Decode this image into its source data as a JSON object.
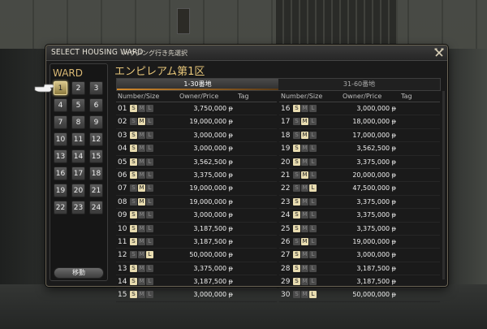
{
  "window": {
    "title": "SELECT HOUSING WARD",
    "subtitle": "ハウジング行き先選択",
    "close_icon": "crossed-hammers-icon"
  },
  "ward": {
    "label": "WARD",
    "selected": 1,
    "buttons": [
      "1",
      "2",
      "3",
      "4",
      "5",
      "6",
      "7",
      "8",
      "9",
      "10",
      "11",
      "12",
      "13",
      "14",
      "15",
      "16",
      "17",
      "18",
      "19",
      "20",
      "21",
      "22",
      "23",
      "24"
    ],
    "move_label": "移動"
  },
  "area_title": "エンピレアム第1区",
  "tabs": [
    {
      "label": "1-30番地",
      "active": true
    },
    {
      "label": "31-60番地",
      "active": false
    }
  ],
  "columns": {
    "number_size": "Number/Size",
    "owner_price": "Owner/Price",
    "tag": "Tag"
  },
  "size_letters": [
    "S",
    "M",
    "L"
  ],
  "plots": [
    {
      "num": "01",
      "size": "S",
      "price": "3,750,000 ᵽ"
    },
    {
      "num": "02",
      "size": "M",
      "price": "19,000,000 ᵽ"
    },
    {
      "num": "03",
      "size": "S",
      "price": "3,000,000 ᵽ"
    },
    {
      "num": "04",
      "size": "S",
      "price": "3,000,000 ᵽ"
    },
    {
      "num": "05",
      "size": "S",
      "price": "3,562,500 ᵽ"
    },
    {
      "num": "06",
      "size": "S",
      "price": "3,375,000 ᵽ"
    },
    {
      "num": "07",
      "size": "M",
      "price": "19,000,000 ᵽ"
    },
    {
      "num": "08",
      "size": "M",
      "price": "19,000,000 ᵽ"
    },
    {
      "num": "09",
      "size": "S",
      "price": "3,000,000 ᵽ"
    },
    {
      "num": "10",
      "size": "S",
      "price": "3,187,500 ᵽ"
    },
    {
      "num": "11",
      "size": "S",
      "price": "3,187,500 ᵽ"
    },
    {
      "num": "12",
      "size": "L",
      "price": "50,000,000 ᵽ"
    },
    {
      "num": "13",
      "size": "S",
      "price": "3,375,000 ᵽ"
    },
    {
      "num": "14",
      "size": "S",
      "price": "3,187,500 ᵽ"
    },
    {
      "num": "15",
      "size": "S",
      "price": "3,000,000 ᵽ"
    },
    {
      "num": "16",
      "size": "S",
      "price": "3,000,000 ᵽ"
    },
    {
      "num": "17",
      "size": "M",
      "price": "18,000,000 ᵽ"
    },
    {
      "num": "18",
      "size": "M",
      "price": "17,000,000 ᵽ"
    },
    {
      "num": "19",
      "size": "S",
      "price": "3,562,500 ᵽ"
    },
    {
      "num": "20",
      "size": "S",
      "price": "3,375,000 ᵽ"
    },
    {
      "num": "21",
      "size": "M",
      "price": "20,000,000 ᵽ"
    },
    {
      "num": "22",
      "size": "L",
      "price": "47,500,000 ᵽ"
    },
    {
      "num": "23",
      "size": "S",
      "price": "3,375,000 ᵽ"
    },
    {
      "num": "24",
      "size": "S",
      "price": "3,375,000 ᵽ"
    },
    {
      "num": "25",
      "size": "S",
      "price": "3,375,000 ᵽ"
    },
    {
      "num": "26",
      "size": "M",
      "price": "19,000,000 ᵽ"
    },
    {
      "num": "27",
      "size": "S",
      "price": "3,000,000 ᵽ"
    },
    {
      "num": "28",
      "size": "S",
      "price": "3,187,500 ᵽ"
    },
    {
      "num": "29",
      "size": "S",
      "price": "3,187,500 ᵽ"
    },
    {
      "num": "30",
      "size": "L",
      "price": "50,000,000 ᵽ"
    }
  ],
  "colors": {
    "accent_gold": "#e8c77a",
    "tab_underline": "#d28a2e"
  }
}
